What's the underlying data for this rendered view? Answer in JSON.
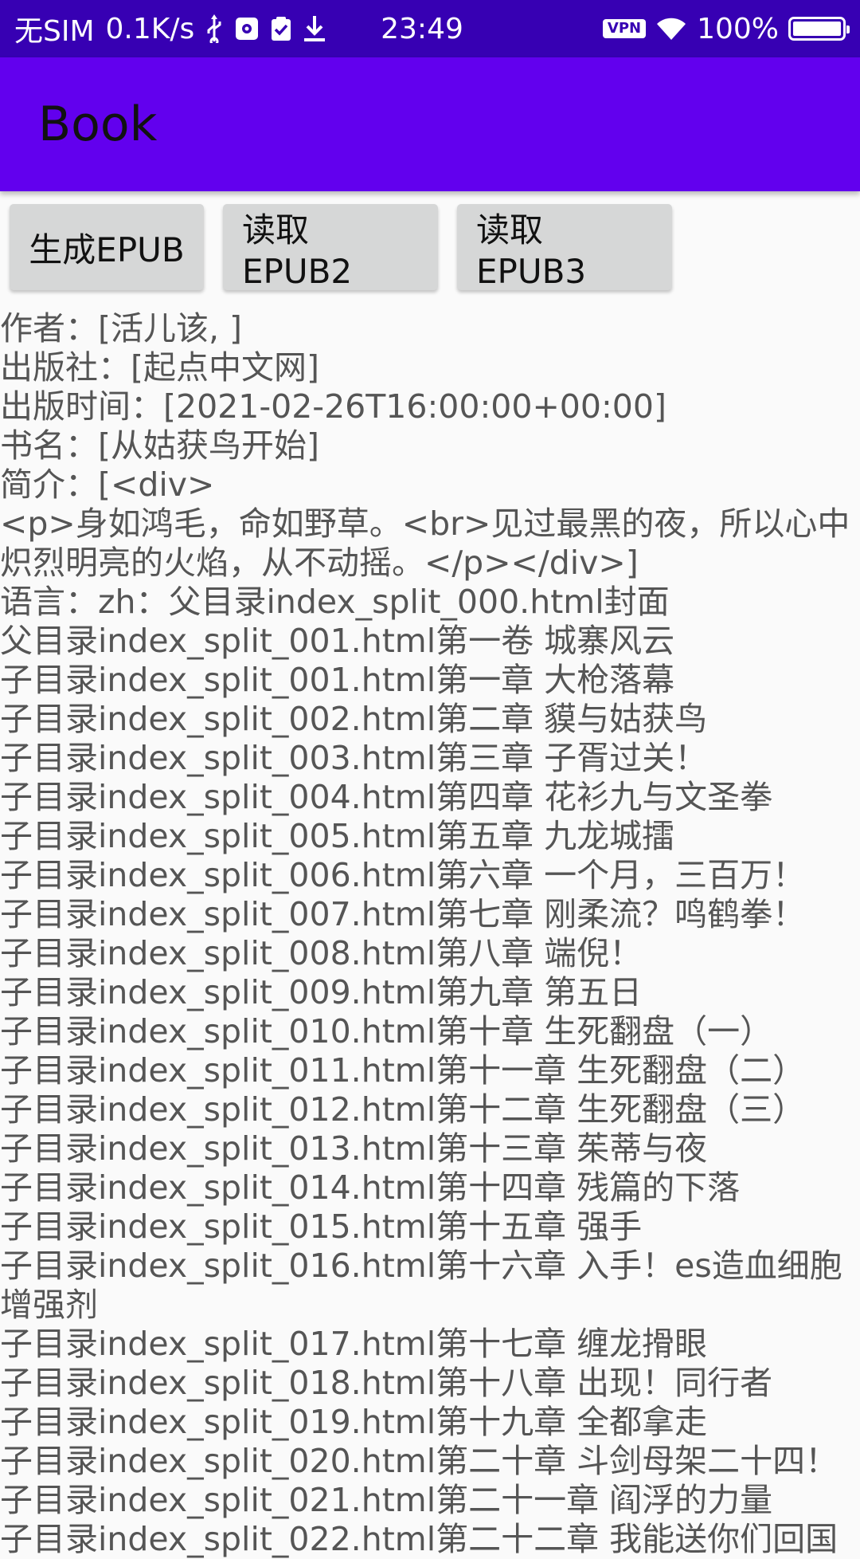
{
  "status_bar": {
    "carrier": "无SIM",
    "speed": "0.1K/s",
    "time": "23:49",
    "vpn": "VPN",
    "battery": "100%",
    "battery_level": 1.0
  },
  "app_bar": {
    "title": "Book"
  },
  "buttons": {
    "generate": "生成EPUB",
    "read2": "读取EPUB2",
    "read3": "读取EPUB3"
  },
  "content_lines": [
    "作者：[活儿该, ]",
    "出版社：[起点中文网]",
    "出版时间：[2021-02-26T16:00:00+00:00]",
    "书名：[从姑获鸟开始]",
    "简介：[<div>",
    "<p>身如鸿毛，命如野草。<br>见过最黑的夜，所以心中炽烈明亮的火焰，从不动摇。</p></div>]",
    "语言：zh：父目录index_split_000.html封面",
    "父目录index_split_001.html第一卷 城寨风云",
    "子目录index_split_001.html第一章 大枪落幕",
    "子目录index_split_002.html第二章 貘与姑获鸟",
    "子目录index_split_003.html第三章 子胥过关！",
    "子目录index_split_004.html第四章 花衫九与文圣拳",
    "子目录index_split_005.html第五章 九龙城擂",
    "子目录index_split_006.html第六章 一个月，三百万！",
    "子目录index_split_007.html第七章 刚柔流？鸣鹤拳！",
    "子目录index_split_008.html第八章 端倪！",
    "子目录index_split_009.html第九章 第五日",
    "子目录index_split_010.html第十章 生死翻盘（一）",
    "子目录index_split_011.html第十一章 生死翻盘（二）",
    "子目录index_split_012.html第十二章 生死翻盘（三）",
    "子目录index_split_013.html第十三章 茱蒂与夜",
    "子目录index_split_014.html第十四章 残篇的下落",
    "子目录index_split_015.html第十五章 强手",
    "子目录index_split_016.html第十六章 入手！es造血细胞增强剂",
    "子目录index_split_017.html第十七章 缠龙搰眼",
    "子目录index_split_018.html第十八章 出现！同行者",
    "子目录index_split_019.html第十九章 全都拿走",
    "子目录index_split_020.html第二十章 斗剑母架二十四！",
    "子目录index_split_021.html第二十一章 阎浮的力量",
    "子目录index_split_022.html第二十二章 我能送你们回国"
  ]
}
